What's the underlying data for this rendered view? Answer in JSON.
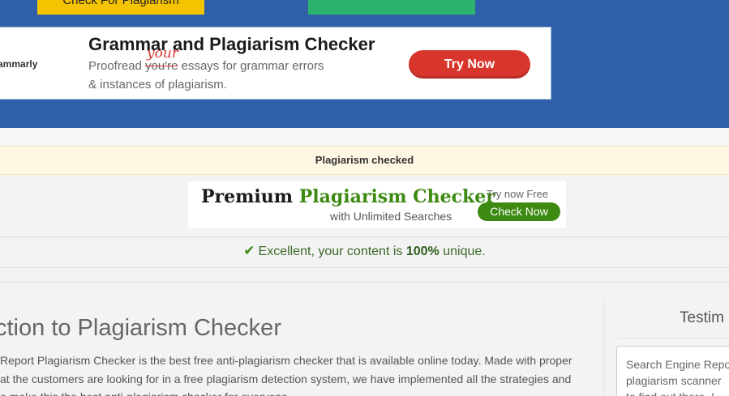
{
  "top_buttons": {
    "check_label": "Check For Plagiarism",
    "colors": {
      "yellow": "#f5c400",
      "green": "#2bb36e",
      "band": "#2e5fa8"
    }
  },
  "ad": {
    "brand": "grammarly",
    "title": "Grammar and Plagiarism Checker",
    "line1_before": "Proofread ",
    "struck_word": "you're",
    "handwritten": "your",
    "line1_after": " essays for grammar errors",
    "line2": "& instances of plagiarism.",
    "cta": "Try Now",
    "cta_color": "#d8362d"
  },
  "status": {
    "text": "Plagiarism checked"
  },
  "premium": {
    "title_black": "Premium ",
    "title_green": "Plagiarism Checker",
    "subtitle": "with Unlimited Searches",
    "try_text": "Try now Free",
    "button": "Check Now",
    "accent": "#3d8a12"
  },
  "result": {
    "icon": "check-icon",
    "before": "Excellent, your content is ",
    "percent": "100%",
    "after": " unique."
  },
  "main": {
    "title": "ction to Plagiarism Checker",
    "lines": [
      "Report Plagiarism Checker is the best free anti-plagiarism checker that is available online today. Made with proper",
      "at the customers are looking for in a free plagiarism detection system, we have implemented all the strategies and",
      "o make this the best anti-plagiarism checker for everyone."
    ]
  },
  "sidebar": {
    "title": "Testim",
    "lines": [
      "Search Engine Repo",
      "plagiarism scanner",
      "to find out there. I"
    ]
  }
}
